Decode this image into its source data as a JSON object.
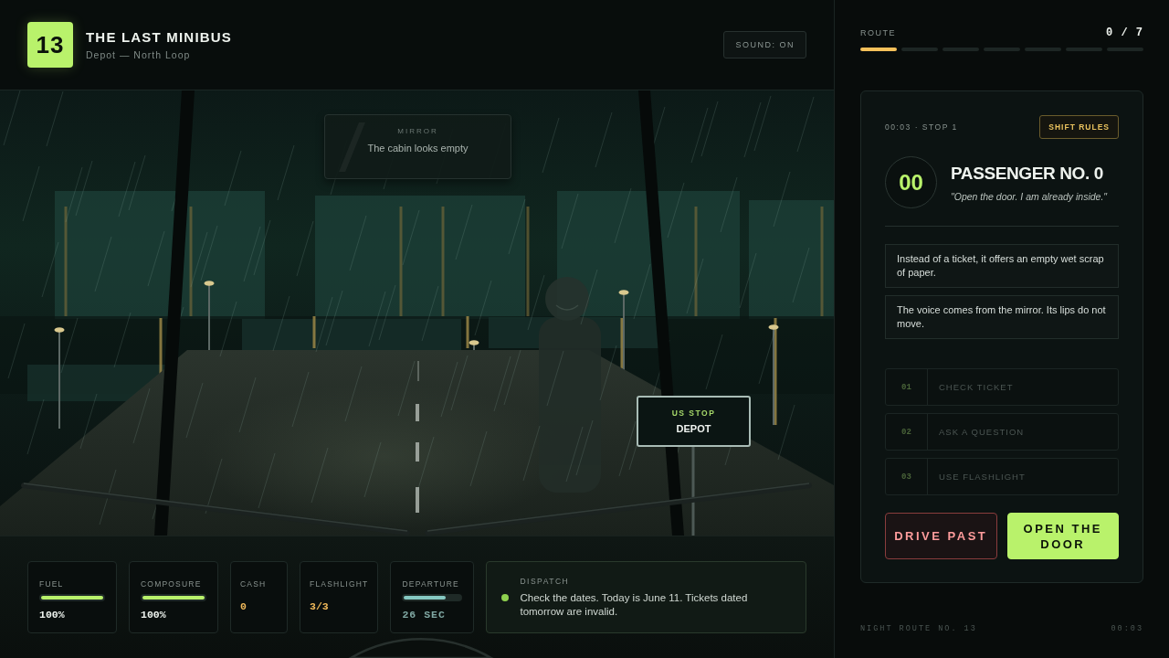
{
  "header": {
    "badge": "13",
    "title": "THE LAST MINIBUS",
    "subtitle": "Depot — North Loop",
    "sound_button": "SOUND: ON"
  },
  "scene": {
    "mirror": {
      "label": "MIRROR",
      "text": "The cabin looks empty"
    },
    "stop_sign": {
      "label": "US STOP",
      "name": "DEPOT"
    }
  },
  "stats": [
    {
      "kind": "meter",
      "label": "FUEL",
      "level": 1,
      "value": "100%"
    },
    {
      "kind": "meter",
      "label": "COMPOSURE",
      "level": 1,
      "value": "100%"
    },
    {
      "kind": "counter",
      "label": "CASH",
      "value": "0"
    },
    {
      "kind": "counter",
      "label": "FLASHLIGHT",
      "value": "3/3"
    },
    {
      "kind": "timer",
      "label": "DEPARTURE",
      "level": 0.74,
      "value": "26 SEC"
    }
  ],
  "dispatch": {
    "label": "DISPATCH",
    "message": "Check the dates. Today is June 11. Tickets dated tomorrow are invalid."
  },
  "route": {
    "label": "ROUTE",
    "count": "0 / 7",
    "stops": [
      {
        "current": true
      },
      {
        "current": false
      },
      {
        "current": false
      },
      {
        "current": false
      },
      {
        "current": false
      },
      {
        "current": false
      },
      {
        "current": false
      }
    ]
  },
  "card": {
    "meta": "00:03 · STOP 1",
    "rules_button": "SHIFT RULES",
    "passenger": {
      "number": "00",
      "name": "PASSENGER NO. 0",
      "quote": "\"Open the door. I am already inside.\""
    },
    "clues": [
      "Instead of a ticket, it offers an empty wet scrap of paper.",
      "The voice comes from the mirror. Its lips do not move."
    ],
    "actions": [
      {
        "number": "01",
        "label": "CHECK TICKET",
        "disabled": true
      },
      {
        "number": "02",
        "label": "ASK A QUESTION",
        "disabled": true
      },
      {
        "number": "03",
        "label": "USE FLASHLIGHT",
        "disabled": true
      }
    ],
    "buttons": [
      {
        "kind": "danger",
        "label": "DRIVE PAST"
      },
      {
        "kind": "primary",
        "label": "OPEN THE DOOR"
      }
    ]
  },
  "footer": {
    "route_name": "NIGHT ROUTE NO. 13",
    "clock": "00:03"
  }
}
